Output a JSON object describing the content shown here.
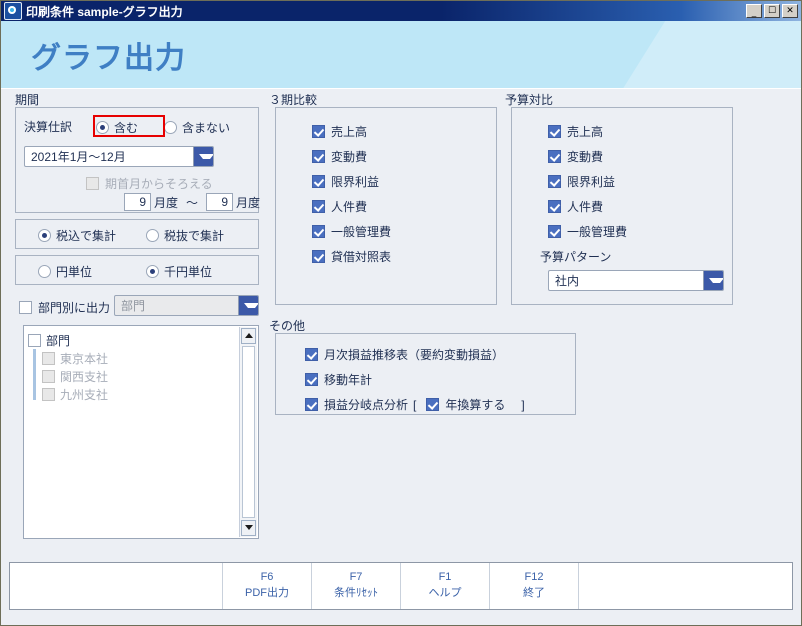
{
  "window": {
    "title": "印刷条件 sample-グラフ出力",
    "icon": "app-icon",
    "minimize": "_",
    "maximize": "☐",
    "close": "✕"
  },
  "banner": {
    "title": "グラフ出力"
  },
  "period": {
    "section_label": "期間",
    "settlement_label": "決算仕訳",
    "settlement_options": [
      {
        "label": "含む",
        "selected": true,
        "highlighted": true
      },
      {
        "label": "含まない",
        "selected": false,
        "highlighted": false
      }
    ],
    "range_value": "2021年1月～12月",
    "align_from_first_month": {
      "label": "期首月からそろえる",
      "checked": false,
      "disabled": true
    },
    "month_from": "9",
    "month_from_unit": "月度",
    "month_separator": "～",
    "month_to": "9",
    "month_to_unit": "月度",
    "tax_options": [
      {
        "label": "税込で集計",
        "selected": true
      },
      {
        "label": "税抜で集計",
        "selected": false
      }
    ],
    "unit_options": [
      {
        "label": "円単位",
        "selected": false
      },
      {
        "label": "千円単位",
        "selected": true
      }
    ],
    "by_department": {
      "label": "部門別に出力",
      "checked": false
    },
    "department_combo_value": "部門",
    "tree": {
      "root": {
        "label": "部門",
        "checked": false
      },
      "children": [
        {
          "label": "東京本社",
          "checked": false
        },
        {
          "label": "関西支社",
          "checked": false
        },
        {
          "label": "九州支社",
          "checked": false
        }
      ]
    }
  },
  "three_period": {
    "section_label": "３期比較",
    "items": [
      {
        "label": "売上高",
        "checked": true
      },
      {
        "label": "変動費",
        "checked": true
      },
      {
        "label": "限界利益",
        "checked": true
      },
      {
        "label": "人件費",
        "checked": true
      },
      {
        "label": "一般管理費",
        "checked": true
      },
      {
        "label": "貸借対照表",
        "checked": true
      }
    ]
  },
  "budget_compare": {
    "section_label": "予算対比",
    "items": [
      {
        "label": "売上高",
        "checked": true
      },
      {
        "label": "変動費",
        "checked": true
      },
      {
        "label": "限界利益",
        "checked": true
      },
      {
        "label": "人件費",
        "checked": true
      },
      {
        "label": "一般管理費",
        "checked": true
      }
    ],
    "pattern_label": "予算パターン",
    "pattern_value": "社内"
  },
  "others": {
    "section_label": "その他",
    "items": [
      {
        "label": "月次損益推移表（要約変動損益）",
        "checked": true
      },
      {
        "label": "移動年計",
        "checked": true
      },
      {
        "label": "損益分岐点分析",
        "checked": true
      }
    ],
    "bracket_open": "[",
    "annualize": {
      "label": "年換算する",
      "checked": true
    },
    "bracket_close": "]"
  },
  "footer": {
    "keys": [
      {
        "key": "F6",
        "name": "PDF出力"
      },
      {
        "key": "F7",
        "name": "条件ﾘｾｯﾄ"
      },
      {
        "key": "F1",
        "name": "ヘルプ"
      },
      {
        "key": "F12",
        "name": "終了"
      }
    ]
  },
  "colors": {
    "titlebar": "#0a246a",
    "banner": "#bee7f7",
    "banner_text": "#3f7fc4",
    "accent": "#3c59a8",
    "checkbox_on": "#4a6fc0",
    "highlight": "#e70000",
    "workspace": "#eceff4"
  }
}
